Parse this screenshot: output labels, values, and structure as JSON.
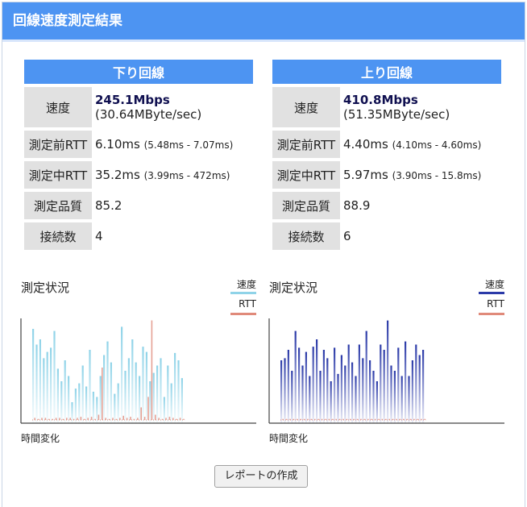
{
  "header": {
    "title": "回線速度測定結果"
  },
  "down": {
    "title": "下り回線",
    "speed_label": "速度",
    "speed_main": "245.1Mbps",
    "speed_sub": "(30.64MByte/sec)",
    "rtt_before_label": "測定前RTT",
    "rtt_before": "6.10ms",
    "rtt_before_range": "(5.48ms - 7.07ms)",
    "rtt_during_label": "測定中RTT",
    "rtt_during": "35.2ms",
    "rtt_during_range": "(3.99ms - 472ms)",
    "quality_label": "測定品質",
    "quality": "85.2",
    "conn_label": "接続数",
    "conn": "4"
  },
  "up": {
    "title": "上り回線",
    "speed_label": "速度",
    "speed_main": "410.8Mbps",
    "speed_sub": "(51.35MByte/sec)",
    "rtt_before_label": "測定前RTT",
    "rtt_before": "4.40ms",
    "rtt_before_range": "(4.10ms - 4.60ms)",
    "rtt_during_label": "測定中RTT",
    "rtt_during": "5.97ms",
    "rtt_during_range": "(3.90ms - 15.8ms)",
    "quality_label": "測定品質",
    "quality": "88.9",
    "conn_label": "接続数",
    "conn": "6"
  },
  "colors": {
    "accent": "#4d94f2",
    "down_speed": "#8fd3e8",
    "up_speed": "#2b3aa8",
    "rtt": "#e08a7a"
  },
  "chart_data": [
    {
      "type": "bar",
      "title": "測定状況",
      "xlabel": "時間変化",
      "legend": [
        "速度",
        "RTT"
      ],
      "series": [
        {
          "name": "速度",
          "values": [
            0.9,
            0.75,
            0.8,
            0.62,
            0.68,
            0.72,
            0.88,
            0.52,
            0.4,
            0.6,
            0.45,
            0.2,
            0.33,
            0.38,
            0.55,
            0.35,
            0.7,
            0.3,
            0.25,
            0.45,
            0.65,
            0.78,
            0.58,
            0.28,
            0.38,
            0.92,
            0.5,
            0.62,
            0.8,
            0.58,
            0.45,
            0.73,
            0.68,
            0.4,
            0.48,
            0.55,
            0.62,
            0.25,
            0.55,
            0.38,
            0.67,
            0.6,
            0.43
          ]
        },
        {
          "name": "RTT",
          "values": [
            0.02,
            0.01,
            0.02,
            0.02,
            0.01,
            0.01,
            0.02,
            0.02,
            0.01,
            0.02,
            0.02,
            0.01,
            0.02,
            0.03,
            0.01,
            0.02,
            0.03,
            0.01,
            0.05,
            0.5,
            0.02,
            0.01,
            0.02,
            0.01,
            0.02,
            0.04,
            0.02,
            0.03,
            0.01,
            0.02,
            0.12,
            0.03,
            0.22,
            0.95,
            0.05,
            0.02,
            0.01,
            0.02,
            0.03,
            0.02,
            0.01,
            0.02,
            0.01
          ]
        }
      ]
    },
    {
      "type": "bar",
      "title": "測定状況",
      "xlabel": "時間変化",
      "legend": [
        "速度",
        "RTT"
      ],
      "series": [
        {
          "name": "速度",
          "values": [
            0.6,
            0.62,
            0.7,
            0.5,
            0.88,
            0.72,
            0.55,
            0.68,
            0.45,
            0.73,
            0.8,
            0.5,
            0.7,
            0.62,
            0.4,
            0.72,
            0.47,
            0.65,
            0.55,
            0.75,
            0.58,
            0.45,
            0.75,
            0.62,
            0.88,
            0.6,
            0.5,
            0.4,
            0.75,
            0.7,
            0.98,
            0.55,
            0.5,
            0.72,
            0.45,
            0.78,
            0.45,
            0.6,
            0.75,
            0.65,
            0.7
          ]
        },
        {
          "name": "RTT",
          "values": [
            0.01,
            0.01,
            0.01,
            0.01,
            0.01,
            0.01,
            0.01,
            0.01,
            0.01,
            0.01,
            0.01,
            0.01,
            0.01,
            0.01,
            0.01,
            0.01,
            0.01,
            0.01,
            0.01,
            0.01,
            0.01,
            0.01,
            0.01,
            0.01,
            0.01,
            0.01,
            0.01,
            0.01,
            0.01,
            0.01,
            0.01,
            0.01,
            0.01,
            0.01,
            0.01,
            0.01,
            0.01,
            0.01,
            0.01,
            0.01,
            0.01
          ]
        }
      ]
    }
  ],
  "report_button": "レポートの作成"
}
